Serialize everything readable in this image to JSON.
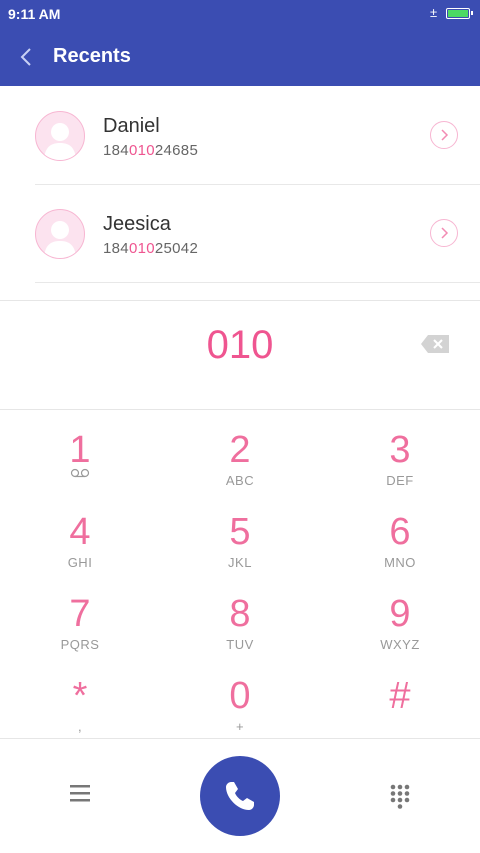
{
  "status": {
    "time": "9:11 AM",
    "signal": "±"
  },
  "header": {
    "title": "Recents"
  },
  "contacts": [
    {
      "name": "Daniel",
      "number_pre": "184",
      "number_match": "010",
      "number_post": "24685"
    },
    {
      "name": "Jeesica",
      "number_pre": "184",
      "number_match": "010",
      "number_post": "25042"
    }
  ],
  "dialer": {
    "input": "010"
  },
  "keypad": [
    {
      "digit": "1",
      "sub": ""
    },
    {
      "digit": "2",
      "sub": "ABC"
    },
    {
      "digit": "3",
      "sub": "DEF"
    },
    {
      "digit": "4",
      "sub": "GHI"
    },
    {
      "digit": "5",
      "sub": "JKL"
    },
    {
      "digit": "6",
      "sub": "MNO"
    },
    {
      "digit": "7",
      "sub": "PQRS"
    },
    {
      "digit": "8",
      "sub": "TUV"
    },
    {
      "digit": "9",
      "sub": "WXYZ"
    },
    {
      "digit": "*",
      "sub": ","
    },
    {
      "digit": "0",
      "sub": "+"
    },
    {
      "digit": "#",
      "sub": ""
    }
  ],
  "colors": {
    "primary": "#3b4db2",
    "accent": "#ef5590"
  },
  "icons": {
    "key1_sub": "voicemail-icon",
    "menu": "menu-icon",
    "call": "phone-icon",
    "dialpad": "dialpad-icon",
    "backspace": "backspace-icon"
  }
}
